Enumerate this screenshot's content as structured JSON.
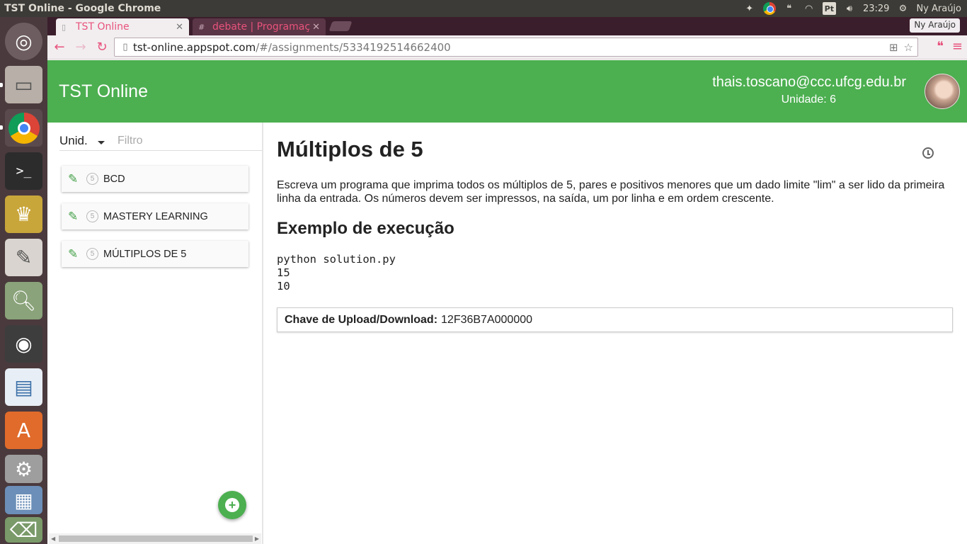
{
  "os_panel": {
    "window_title": "TST Online - Google Chrome",
    "input_method": "Pt",
    "time": "23:29",
    "user": "Ny Araújo"
  },
  "browser": {
    "tabs": [
      {
        "label": "TST Online",
        "active": true
      },
      {
        "label": "debate | Programaç",
        "active": false
      }
    ],
    "profile_badge": "Ny Araújo",
    "url_host": "tst-online.appspot.com",
    "url_path": "/#/assignments/5334192514662400"
  },
  "header": {
    "title": "TST Online",
    "email": "thais.toscano@ccc.ufcg.edu.br",
    "unit": "Unidade: 6"
  },
  "sidebar": {
    "unit_select": "Unid.",
    "filter_placeholder": "Filtro",
    "items": [
      {
        "unit": "5",
        "label": "BCD"
      },
      {
        "unit": "5",
        "label": "MASTERY LEARNING"
      },
      {
        "unit": "5",
        "label": "MÚLTIPLOS DE 5"
      }
    ],
    "add_button_label": "+"
  },
  "assignment": {
    "title": "Múltiplos de 5",
    "description": "Escreva um programa que imprima todos os múltiplos de 5, pares e positivos menores que um dado limite \"lim\" a ser lido da primeira linha da entrada. Os números devem ser impressos, na saída, um por linha e em ordem crescente.",
    "example_heading": "Exemplo de execução",
    "example_code": "python solution.py\n15\n10",
    "key_label": "Chave de Upload/Download:",
    "key_value": "12F36B7A000000"
  },
  "colors": {
    "header_green": "#4caf50",
    "chrome_accent": "#e8527c",
    "launcher_bg": "#4a3a3d"
  }
}
